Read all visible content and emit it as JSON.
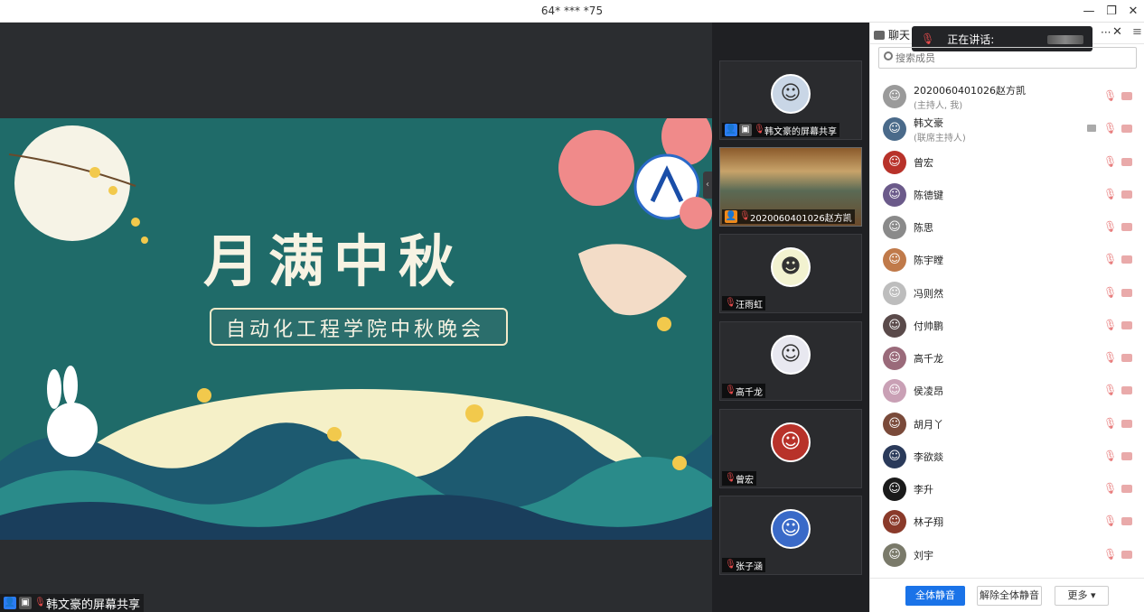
{
  "window": {
    "title": "64* *** *75",
    "minimize": "—",
    "restore": "❐",
    "close": "✕"
  },
  "share": {
    "slide_title": "月满中秋",
    "slide_subtitle": "自动化工程学院中秋晚会",
    "label": "韩文豪的屏幕共享"
  },
  "strip": {
    "collapse": "‹",
    "tiles": [
      {
        "name": "韩文豪的屏幕共享"
      },
      {
        "name": "2020060401026赵方凯"
      },
      {
        "name": "汪雨虹"
      },
      {
        "name": "高千龙"
      },
      {
        "name": "曾宏"
      },
      {
        "name": "张子涵"
      }
    ]
  },
  "panel": {
    "tab_chat": "聊天",
    "speaking_label": "正在讲话:",
    "more": "···",
    "close": "✕",
    "menu": "≡",
    "search_placeholder": "搜索成员",
    "members": [
      {
        "name": "2020060401026赵方凯",
        "role": "(主持人, 我)",
        "color": "#9a9a9a"
      },
      {
        "name": "韩文豪",
        "role": "(联席主持人)",
        "color": "#4a6a8a"
      },
      {
        "name": "曾宏",
        "role": "",
        "color": "#b8322a"
      },
      {
        "name": "陈德键",
        "role": "",
        "color": "#6b5a8a"
      },
      {
        "name": "陈思",
        "role": "",
        "color": "#8a8a8a"
      },
      {
        "name": "陈宇瞠",
        "role": "",
        "color": "#c07a4a"
      },
      {
        "name": "冯则然",
        "role": "",
        "color": "#bdbdbd"
      },
      {
        "name": "付帅鹏",
        "role": "",
        "color": "#5a4a4a"
      },
      {
        "name": "高千龙",
        "role": "",
        "color": "#9a6a7a"
      },
      {
        "name": "侯凌昂",
        "role": "",
        "color": "#c9a0b5"
      },
      {
        "name": "胡月丫",
        "role": "",
        "color": "#7a4a3a"
      },
      {
        "name": "李欲燚",
        "role": "",
        "color": "#2a3a5a"
      },
      {
        "name": "李升",
        "role": "",
        "color": "#1a1a1a"
      },
      {
        "name": "林子翔",
        "role": "",
        "color": "#8a3a2a"
      },
      {
        "name": "刘宇",
        "role": "",
        "color": "#7a7a6a"
      }
    ],
    "btn_mute_all": "全体静音",
    "btn_unmute_all": "解除全体静音",
    "btn_more": "更多 ▾"
  },
  "colors": {
    "accent": "#1a73e8",
    "muted_red": "#e87c7c",
    "strip_bg": "#1f2023"
  }
}
